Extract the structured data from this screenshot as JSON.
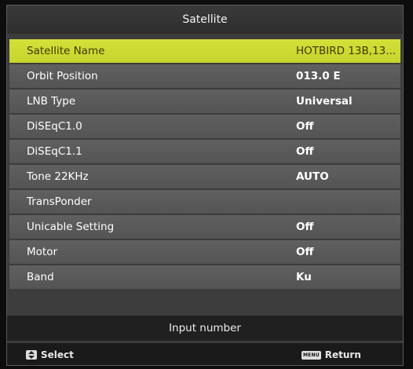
{
  "header": {
    "title": "Satellite"
  },
  "rows": [
    {
      "label": "Satellite Name",
      "value": "HOTBIRD 13B,13..."
    },
    {
      "label": "Orbit Position",
      "value": "013.0 E"
    },
    {
      "label": "LNB Type",
      "value": "Universal"
    },
    {
      "label": "DiSEqC1.0",
      "value": "Off"
    },
    {
      "label": "DiSEqC1.1",
      "value": "Off"
    },
    {
      "label": "Tone 22KHz",
      "value": "AUTO"
    },
    {
      "label": "TransPonder",
      "value": ""
    },
    {
      "label": "Unicable Setting",
      "value": "Off"
    },
    {
      "label": "Motor",
      "value": "Off"
    },
    {
      "label": "Band",
      "value": "Ku"
    }
  ],
  "hint": {
    "text": "Input number"
  },
  "footer": {
    "select_label": "Select",
    "return_label": "Return",
    "menu_key_text": "MENU"
  },
  "colors": {
    "highlight": "#cbd831",
    "row": "#5a5a5a",
    "background": "#3c3c3c"
  },
  "icons": {
    "select": "up-down-arrows-icon",
    "return": "menu-key-icon"
  },
  "selected_index": 0
}
